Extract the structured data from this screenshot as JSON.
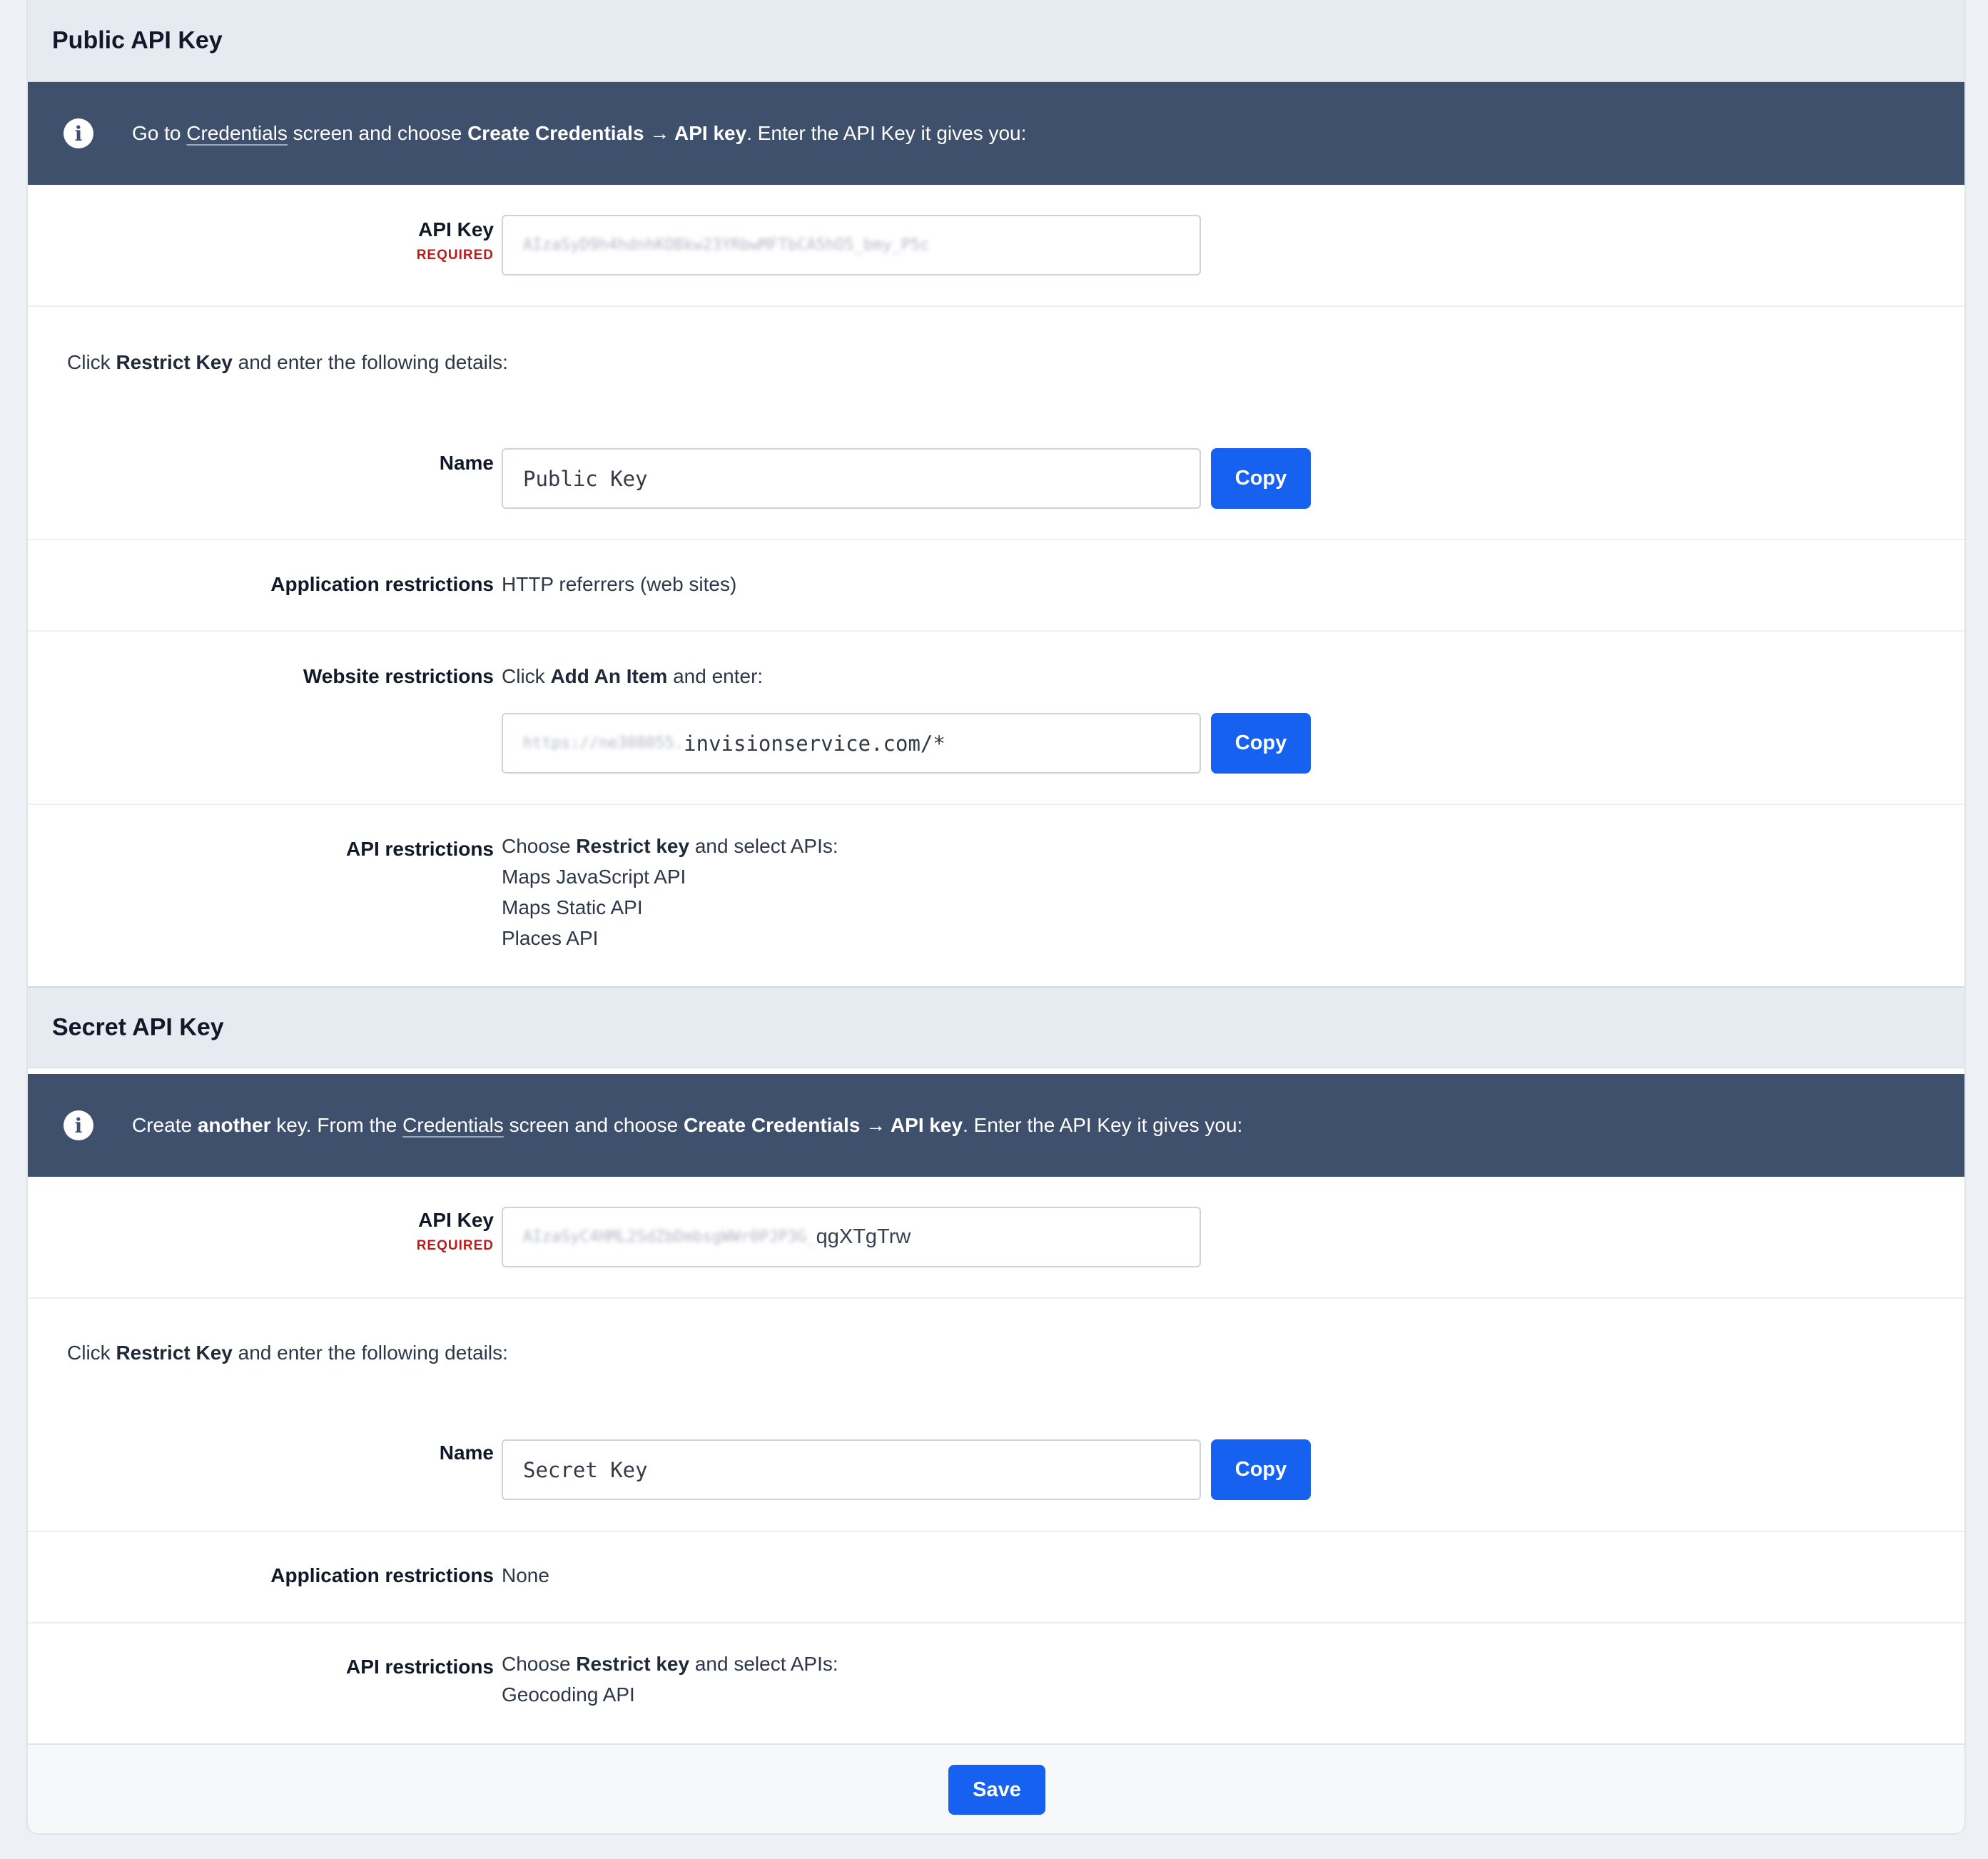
{
  "public_section": {
    "title": "Public API Key",
    "info": {
      "prefix": "Go to ",
      "link": "Credentials",
      "middle": " screen and choose ",
      "bold": "Create Credentials → API key",
      "suffix": ". Enter the API Key it gives you:"
    },
    "api_key": {
      "label": "API Key",
      "required": "REQUIRED",
      "value": "AIzaSyD9h4hdnhKOBkw23YRbwMFTbCA5hO5_bmy_P5c"
    },
    "restrict_note": {
      "prefix": "Click ",
      "bold": "Restrict Key",
      "suffix": " and enter the following details:"
    },
    "name": {
      "label": "Name",
      "value": "Public Key",
      "copy": "Copy"
    },
    "app_restrictions": {
      "label": "Application restrictions",
      "value": "HTTP referrers (web sites)"
    },
    "website_restrictions": {
      "label": "Website restrictions",
      "prefix": "Click ",
      "bold": "Add An Item",
      "suffix": " and enter:",
      "value_hidden": "https://ne308055.",
      "value_visible": "invisionservice.com/*",
      "copy": "Copy"
    },
    "api_restrictions": {
      "label": "API restrictions",
      "prefix": "Choose ",
      "bold": "Restrict key",
      "suffix": " and select APIs:",
      "apis": [
        "Maps JavaScript API",
        "Maps Static API",
        "Places API"
      ]
    }
  },
  "secret_section": {
    "title": "Secret API Key",
    "info": {
      "prefix": "Create ",
      "bold1": "another",
      "mid1": " key. From the ",
      "link": "Credentials",
      "mid2": " screen and choose ",
      "bold2": "Create Credentials → API key",
      "suffix": ". Enter the API Key it gives you:"
    },
    "api_key": {
      "label": "API Key",
      "required": "REQUIRED",
      "value_hidden": "AIzaSyC4HML2SdZbDmbsgWWr0PJP3G_",
      "value_visible": "qgXTgTrw"
    },
    "restrict_note": {
      "prefix": "Click ",
      "bold": "Restrict Key",
      "suffix": " and enter the following details:"
    },
    "name": {
      "label": "Name",
      "value": "Secret Key",
      "copy": "Copy"
    },
    "app_restrictions": {
      "label": "Application restrictions",
      "value": "None"
    },
    "api_restrictions": {
      "label": "API restrictions",
      "prefix": "Choose ",
      "bold": "Restrict key",
      "suffix": " and select APIs:",
      "apis": [
        "Geocoding API"
      ]
    }
  },
  "footer": {
    "save": "Save"
  },
  "colors": {
    "primary": "#1761f0",
    "info_bg": "#3f506c",
    "required": "#b91c1c",
    "section_bg": "#e6eaf1"
  }
}
